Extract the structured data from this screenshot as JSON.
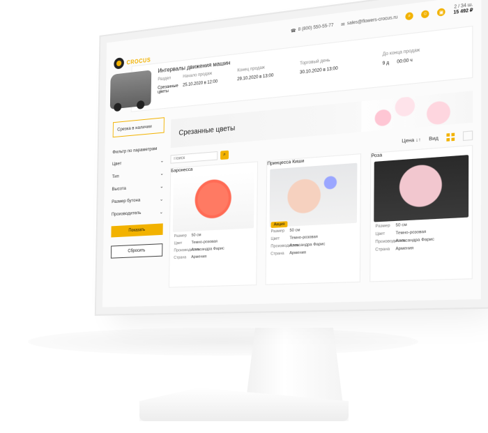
{
  "header": {
    "phone": "8 (800) 550-55-77",
    "email": "sales@flowers-crocus.ru",
    "cart_label": "2 / 34 ш.",
    "cart_total": "15 492 ₽"
  },
  "brand": {
    "name": "CROCUS"
  },
  "intervals": {
    "title": "Интервалы движения машин",
    "cols": [
      "Раздел",
      "Начало продаж",
      "Конец продаж",
      "Торговый день",
      "До конца продаж"
    ],
    "row": [
      "Срезанные цветы",
      "25.10.2020 в 12:00",
      "29.10.2020 в 13:00",
      "30.10.2020 в 13:00",
      "9 д",
      "00:00 ч"
    ]
  },
  "sidebar": {
    "stock_label": "Срезка в наличии",
    "filter_title": "Фильтр по параметрам",
    "filters": [
      "Цвет",
      "Тип",
      "Высота",
      "Размер бутона",
      "Производитель"
    ],
    "show_btn": "Показать",
    "reset_btn": "Сбросить"
  },
  "category": {
    "title": "Срезанные цветы"
  },
  "controls": {
    "search_placeholder": "Поиск",
    "sort_label": "Цена",
    "view_label": "Вид"
  },
  "products": [
    {
      "name": "Баронесса",
      "specs": [
        [
          "Размер",
          "50 см"
        ],
        [
          "Цвет",
          "Темно-розовая"
        ],
        [
          "Производитель",
          "Александра Фарис"
        ],
        [
          "Страна",
          "Армения"
        ]
      ]
    },
    {
      "name": "Принцесса Киши",
      "badge": "Акция",
      "specs": [
        [
          "Размер",
          "50 см"
        ],
        [
          "Цвет",
          "Темно-розовая"
        ],
        [
          "Производитель",
          "Александра Фарис"
        ],
        [
          "Страна",
          "Армения"
        ]
      ]
    },
    {
      "name": "Роза",
      "specs": [
        [
          "Размер",
          "50 см"
        ],
        [
          "Цвет",
          "Темно-розовая"
        ],
        [
          "Производитель",
          "Александра Фарис"
        ],
        [
          "Страна",
          "Армения"
        ]
      ]
    }
  ]
}
